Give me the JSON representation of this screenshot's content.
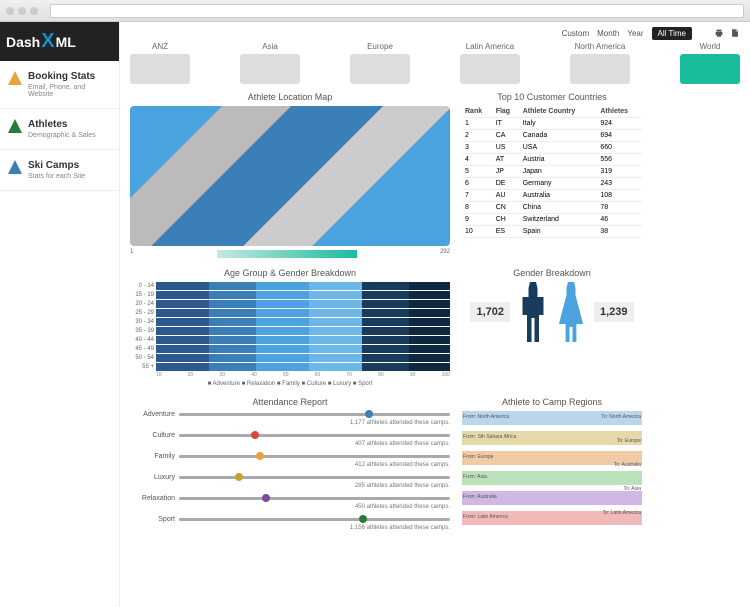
{
  "logo": {
    "part1": "Dash",
    "part2": "ML"
  },
  "time_filters": [
    "Custom",
    "Month",
    "Year",
    "All Time"
  ],
  "time_active": "All Time",
  "nav": [
    {
      "title": "Booking Stats",
      "sub": "Email, Phone, and Website",
      "icon": "pencil",
      "color": "#e8a33d"
    },
    {
      "title": "Athletes",
      "sub": "Demographic & Sales",
      "icon": "skier",
      "color": "#2a7a3a"
    },
    {
      "title": "Ski Camps",
      "sub": "Stats for each Site",
      "icon": "mountain",
      "color": "#3a7fb8"
    }
  ],
  "regions": [
    "ANZ",
    "Asia",
    "Europe",
    "Latin America",
    "North America",
    "World"
  ],
  "map_title": "Athlete Location Map",
  "map_legend": {
    "min": "1",
    "max": "292"
  },
  "countries_title": "Top 10 Customer Countries",
  "countries_headers": [
    "Rank",
    "Flag",
    "Athlete Country",
    "Athletes"
  ],
  "countries": [
    {
      "rank": "1",
      "flag": "IT",
      "name": "Italy",
      "count": "924"
    },
    {
      "rank": "2",
      "flag": "CA",
      "name": "Canada",
      "count": "694"
    },
    {
      "rank": "3",
      "flag": "US",
      "name": "USA",
      "count": "660"
    },
    {
      "rank": "4",
      "flag": "AT",
      "name": "Austria",
      "count": "556"
    },
    {
      "rank": "5",
      "flag": "JP",
      "name": "Japan",
      "count": "319"
    },
    {
      "rank": "6",
      "flag": "DE",
      "name": "Germany",
      "count": "243"
    },
    {
      "rank": "7",
      "flag": "AU",
      "name": "Australia",
      "count": "108"
    },
    {
      "rank": "8",
      "flag": "CN",
      "name": "China",
      "count": "78"
    },
    {
      "rank": "9",
      "flag": "CH",
      "name": "Switzerland",
      "count": "46"
    },
    {
      "rank": "10",
      "flag": "ES",
      "name": "Spain",
      "count": "38"
    }
  ],
  "age_title": "Age Group & Gender Breakdown",
  "age_groups": [
    "0 - 14",
    "15 - 19",
    "20 - 24",
    "25 - 29",
    "30 - 34",
    "35 - 39",
    "40 - 44",
    "45 - 49",
    "50 - 54",
    "55 +"
  ],
  "age_legend": "■ Adventure ■ Relaxation ■ Family ■ Culture ■ Luxury ■ Sport",
  "age_ticks": [
    "10",
    "20",
    "30",
    "40",
    "50",
    "60",
    "70",
    "80",
    "90",
    "100"
  ],
  "gender_title": "Gender Breakdown",
  "gender": {
    "male": "1,702",
    "female": "1,239"
  },
  "attendance_title": "Attendance Report",
  "attendance": [
    {
      "label": "Adventure",
      "color": "#3a7fb8",
      "pct": 70,
      "desc": "1,177 athletes attended these camps."
    },
    {
      "label": "Culture",
      "color": "#d9473a",
      "pct": 28,
      "desc": "407 athletes attended these camps."
    },
    {
      "label": "Family",
      "color": "#e8a33d",
      "pct": 30,
      "desc": "412 athletes attended these camps."
    },
    {
      "label": "Luxury",
      "color": "#c9a030",
      "pct": 22,
      "desc": "285 athletes attended these camps."
    },
    {
      "label": "Relaxation",
      "color": "#7a4aa3",
      "pct": 32,
      "desc": "450 athletes attended these camps."
    },
    {
      "label": "Sport",
      "color": "#2a7a3a",
      "pct": 68,
      "desc": "1,156 athletes attended these camps."
    }
  ],
  "sankey_title": "Athlete to Camp Regions",
  "sankey_from": [
    "From: North America",
    "From: Sth Sahara Africa",
    "From: Europe",
    "From: Asia",
    "From: Australia",
    "From: Latin America"
  ],
  "sankey_to": [
    "To: North America",
    "To: Europe",
    "To: Australia",
    "To: Asia",
    "To: Latin America"
  ],
  "chart_data": {
    "countries_table": {
      "type": "table",
      "columns": [
        "Rank",
        "Flag",
        "Athlete Country",
        "Athletes"
      ],
      "rows": [
        [
          "1",
          "IT",
          "Italy",
          924
        ],
        [
          "2",
          "CA",
          "Canada",
          694
        ],
        [
          "3",
          "US",
          "USA",
          660
        ],
        [
          "4",
          "AT",
          "Austria",
          556
        ],
        [
          "5",
          "JP",
          "Japan",
          319
        ],
        [
          "6",
          "DE",
          "Germany",
          243
        ],
        [
          "7",
          "AU",
          "Australia",
          108
        ],
        [
          "8",
          "CN",
          "China",
          78
        ],
        [
          "9",
          "CH",
          "Switzerland",
          46
        ],
        [
          "10",
          "ES",
          "Spain",
          38
        ]
      ]
    },
    "age_gender": {
      "type": "bar",
      "orientation": "horizontal",
      "stacked": true,
      "categories": [
        "0 - 14",
        "15 - 19",
        "20 - 24",
        "25 - 29",
        "30 - 34",
        "35 - 39",
        "40 - 44",
        "45 - 49",
        "50 - 54",
        "55 +"
      ],
      "series": [
        {
          "name": "Adventure"
        },
        {
          "name": "Relaxation"
        },
        {
          "name": "Family"
        },
        {
          "name": "Culture"
        },
        {
          "name": "Luxury"
        },
        {
          "name": "Sport"
        }
      ],
      "xlim": [
        0,
        100
      ],
      "note": "percent stacked, exact splits not labeled"
    },
    "gender": {
      "type": "bar",
      "categories": [
        "Male",
        "Female"
      ],
      "values": [
        1702,
        1239
      ]
    },
    "attendance": {
      "type": "bar",
      "categories": [
        "Adventure",
        "Culture",
        "Family",
        "Luxury",
        "Relaxation",
        "Sport"
      ],
      "values": [
        1177,
        407,
        412,
        285,
        450,
        1156
      ],
      "unit": "athletes"
    }
  }
}
